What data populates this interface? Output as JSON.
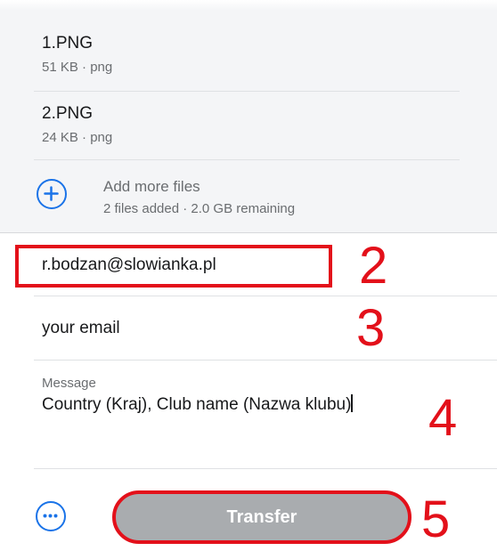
{
  "files": [
    {
      "name": "1.PNG",
      "meta": "51 KB · png"
    },
    {
      "name": "2.PNG",
      "meta": "24 KB · png"
    }
  ],
  "add_more": {
    "title": "Add more files",
    "status": "2 files added · 2.0 GB remaining",
    "icon": "plus-circle-icon"
  },
  "form": {
    "recipient_email": "r.bodzan@slowianka.pl",
    "sender_email": "your email",
    "message_label": "Message",
    "message_text": "Country (Kraj),  Club name (Nazwa klubu)"
  },
  "actions": {
    "more_icon": "ellipsis-circle-icon",
    "transfer_label": "Transfer"
  },
  "annotations": [
    "2",
    "3",
    "4",
    "5"
  ],
  "colors": {
    "accent": "#1a73e8",
    "annotation": "#e3101a",
    "panel": "#f4f5f7",
    "button_disabled": "#a9acaf"
  }
}
